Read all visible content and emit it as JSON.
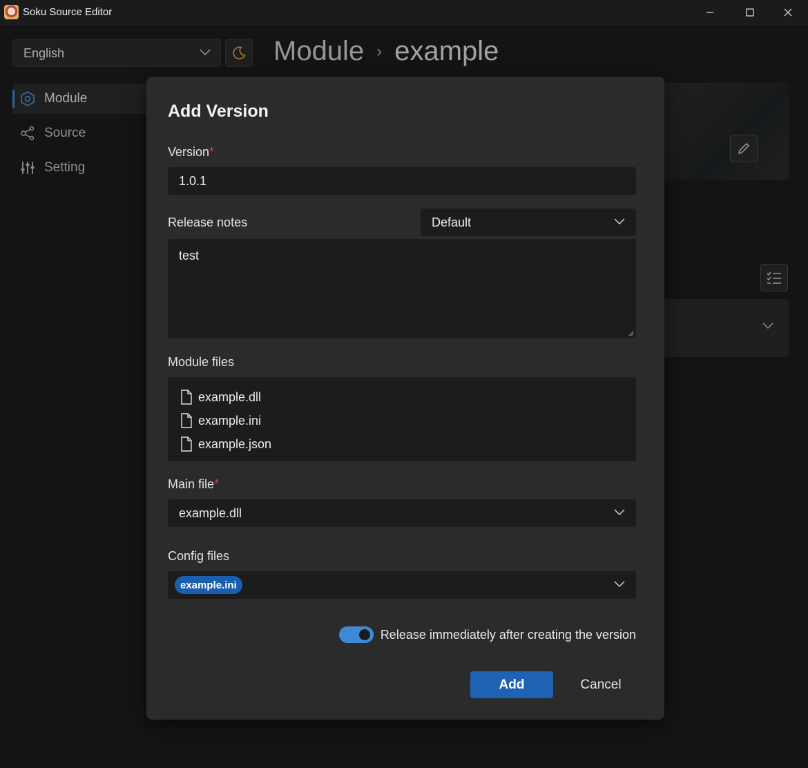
{
  "window": {
    "title": "Soku Source Editor",
    "controls": [
      "minimize-icon",
      "maximize-icon",
      "close-icon"
    ]
  },
  "header": {
    "language": "English",
    "theme_icon": "moon-icon",
    "breadcrumb": [
      "Module",
      "example"
    ]
  },
  "sidebar": {
    "items": [
      {
        "label": "Module",
        "icon": "hexagon-icon",
        "active": true
      },
      {
        "label": "Source",
        "icon": "share-nodes-icon",
        "active": false
      },
      {
        "label": "Setting",
        "icon": "sliders-icon",
        "active": false
      }
    ]
  },
  "dialog": {
    "title": "Add Version",
    "version_label": "Version",
    "version_required_mark": "*",
    "version_value": "1.0.1",
    "release_notes_label": "Release notes",
    "release_notes_format": "Default",
    "release_notes_value": "test",
    "module_files_label": "Module files",
    "module_files": [
      "example.dll",
      "example.ini",
      "example.json"
    ],
    "main_file_label": "Main file",
    "main_file_required_mark": "*",
    "main_file_value": "example.dll",
    "config_files_label": "Config files",
    "config_files_selected": [
      "example.ini"
    ],
    "release_toggle_label": "Release immediately after creating the version",
    "release_toggle_on": true,
    "add_label": "Add",
    "cancel_label": "Cancel"
  },
  "colors": {
    "accent": "#1e63b3",
    "toggle_on": "#3e8ad6",
    "required": "#d33f3f",
    "theme_icon": "#e0a23a"
  }
}
